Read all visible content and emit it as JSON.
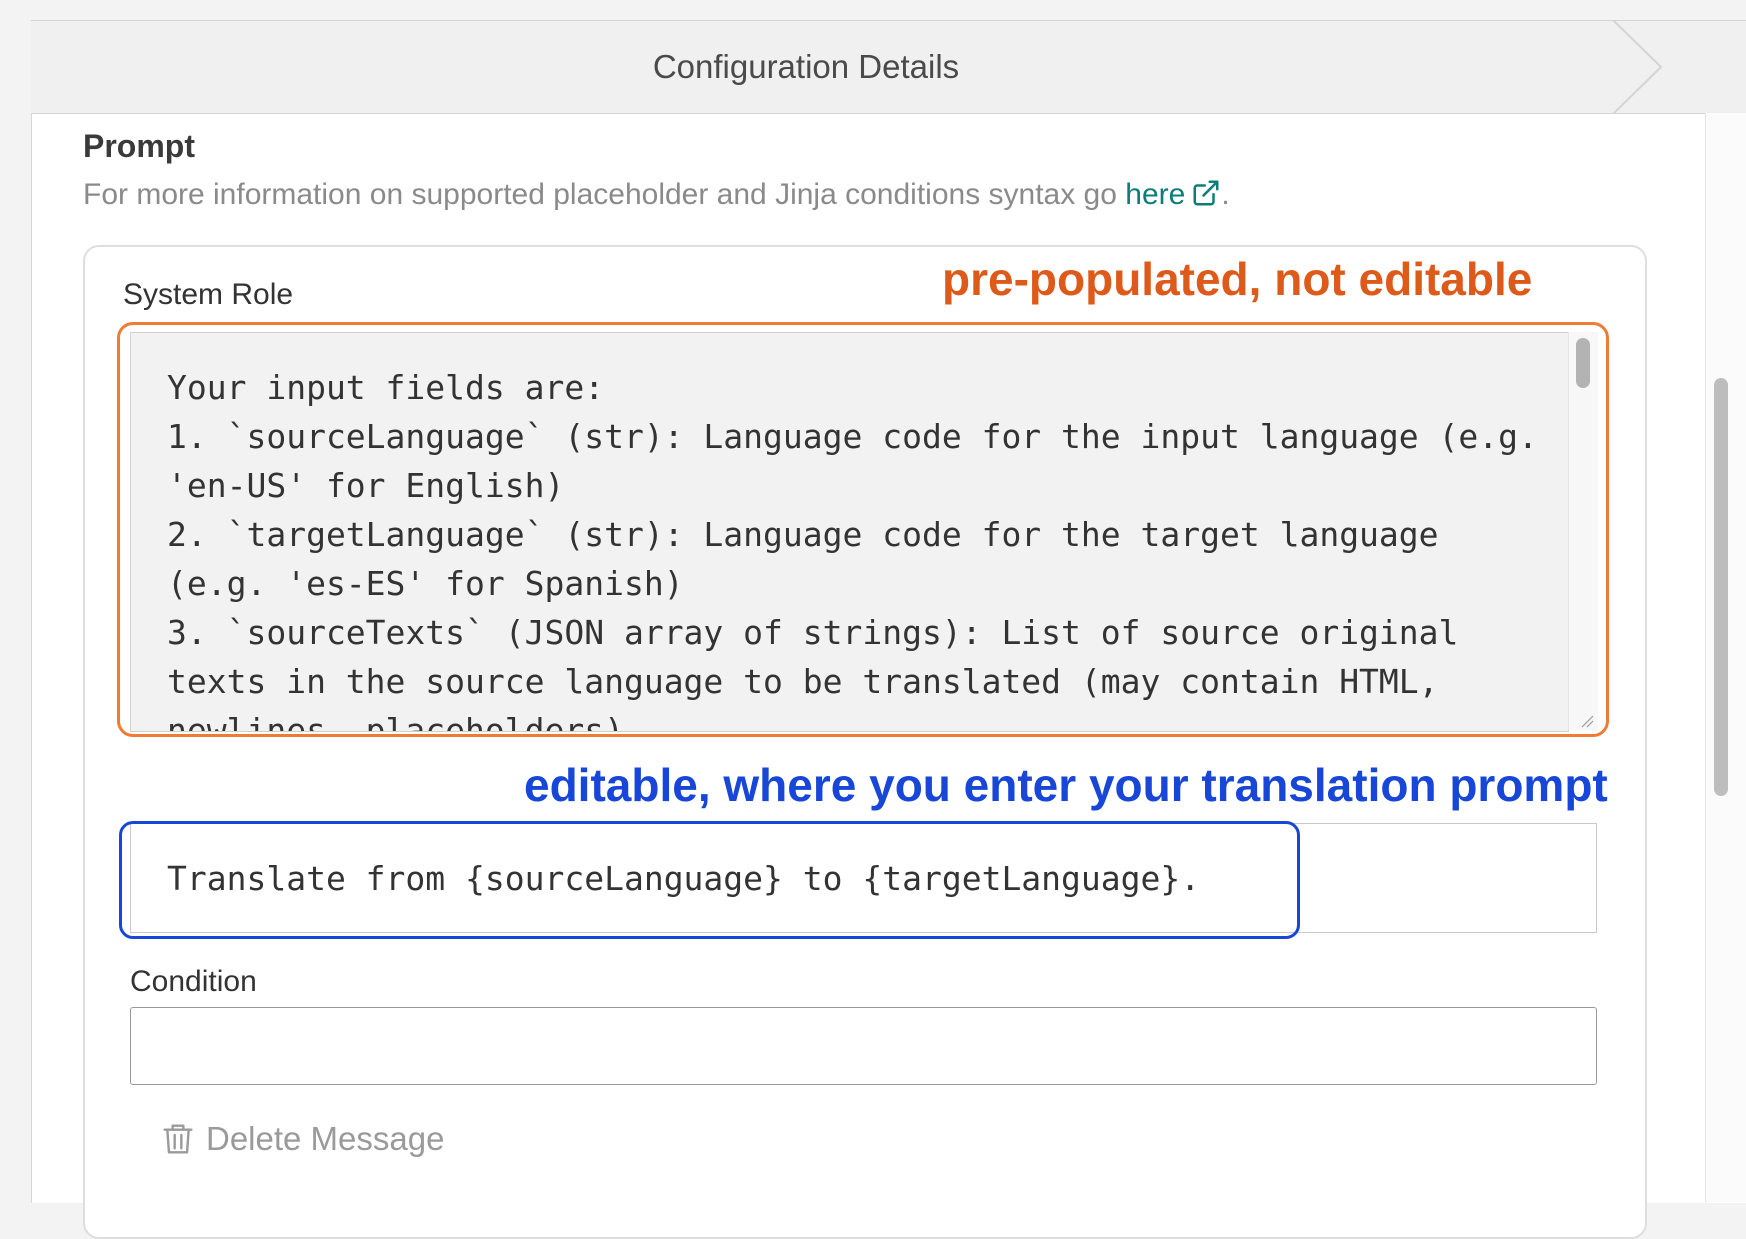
{
  "step_header": {
    "title": "Configuration Details"
  },
  "prompt": {
    "label": "Prompt",
    "help_prefix": "For more information on supported placeholder and Jinja conditions syntax go ",
    "help_link": "here",
    "help_suffix": ".",
    "help_icon": "external-link-icon"
  },
  "system_role": {
    "label": "System Role",
    "value": "Your input fields are:\n1. `sourceLanguage` (str): Language code for the input language (e.g. 'en-US' for English)\n2. `targetLanguage` (str): Language code for the target language (e.g. 'es-ES' for Spanish)\n3. `sourceTexts` (JSON array of strings): List of source original texts in the source language to be translated (may contain HTML, newlines, placeholders)"
  },
  "user_message": {
    "value": "Translate from {sourceLanguage} to {targetLanguage}."
  },
  "condition": {
    "label": "Condition",
    "value": ""
  },
  "delete_message": {
    "label": "Delete Message",
    "icon": "trash-icon"
  },
  "annotations": {
    "system_role_note": "pre-populated, not editable",
    "system_role_color": "#dd5a1b",
    "user_message_note": "editable, where you enter your translation prompt",
    "user_message_color": "#1746d8"
  }
}
